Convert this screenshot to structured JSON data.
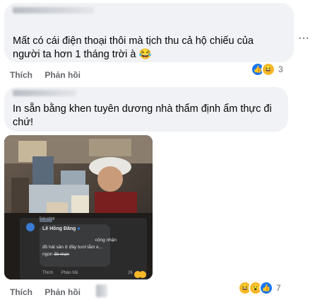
{
  "comment1": {
    "text_line1": "Mất có cái điện thoại thôi mà tịch thu cả hộ chiếu của",
    "text_line2": "người ta hơn 1 tháng trời à",
    "emoji": "😂",
    "actions": {
      "like": "Thích",
      "reply": "Phản hồi"
    },
    "reaction_count": "3"
  },
  "comment2": {
    "text_line1": "In sẵn bằng khen tuyên dương nhà thẩm định ẩm thực đi",
    "text_line2": "chứ!",
    "actions": {
      "like": "Thích",
      "reply": "Phản hồi"
    },
    "reaction_count": "7"
  },
  "embedded_comment": {
    "badge": "Fan cứng",
    "author": "Lê Hồng Đăng",
    "text_line1": "công nhận",
    "text_line2": "đồ hải sản ở đây tươi lắm e...",
    "text_line3": "ngon",
    "strike_word": "đó mạn",
    "like": "Thích",
    "reply": "Phản hồi",
    "time": "2d",
    "reaction_count": "26"
  },
  "more_icon": "⋯"
}
